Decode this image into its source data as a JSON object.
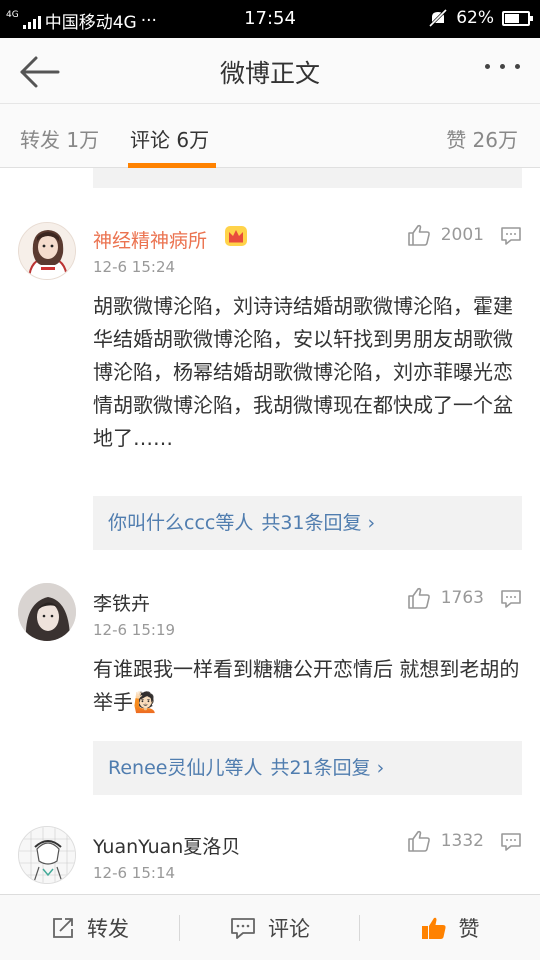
{
  "status_bar": {
    "network_small": "4G",
    "carrier": "中国移动4G",
    "dots": "···",
    "time": "17:54",
    "battery_text": "62%",
    "battery_level": 0.62
  },
  "nav": {
    "title": "微博正文"
  },
  "tabs": {
    "repost": "转发 1万",
    "comment": "评论 6万",
    "like": "赞 26万"
  },
  "comments": [
    {
      "username": "神经精神病所",
      "vip": true,
      "time": "12-6 15:24",
      "likes": "2001",
      "text": "胡歌微博沦陷，刘诗诗结婚胡歌微博沦陷，霍建华结婚胡歌微博沦陷，安以轩找到男朋友胡歌微博沦陷，杨幂结婚胡歌微博沦陷，刘亦菲曝光恋情胡歌微博沦陷，我胡微博现在都快成了一个盆地了……",
      "replies_users": "你叫什么ccc等人",
      "replies_count": "共31条回复",
      "chevron": "›"
    },
    {
      "username": "李铁卉",
      "vip": false,
      "time": "12-6 15:19",
      "likes": "1763",
      "text": "有谁跟我一样看到糖糖公开恋情后 就想到老胡的举手🙋🏻",
      "replies_users": "Renee灵仙儿等人",
      "replies_count": "共21条回复",
      "chevron": "›"
    },
    {
      "username": "YuanYuan夏洛贝",
      "vip": false,
      "time": "12-6 15:14",
      "likes": "1332"
    }
  ],
  "toolbar": {
    "repost": "转发",
    "comment": "评论",
    "like": "赞"
  },
  "icons": {
    "back": "back-arrow-icon",
    "more": "more-dots-icon",
    "like": "thumbs-up-icon",
    "comment": "comment-bubble-icon",
    "crown": "vip-crown-icon"
  },
  "colors": {
    "accent": "#ff8200",
    "vip_name": "#eb7350",
    "reply_link": "#507daf"
  }
}
